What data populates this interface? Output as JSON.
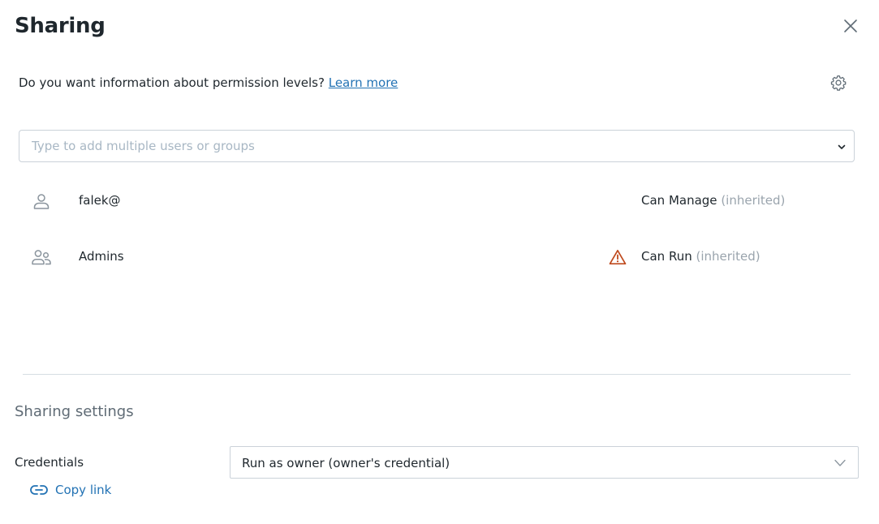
{
  "dialog": {
    "title": "Sharing",
    "close_icon": "close-icon"
  },
  "info": {
    "text": "Do you want information about permission levels? ",
    "link_label": "Learn more",
    "settings_icon": "gear-icon"
  },
  "picker": {
    "placeholder": "Type to add multiple users or groups",
    "value": ""
  },
  "permissions": [
    {
      "principal": "falek@",
      "type_icon": "user-icon",
      "permission": "Can Manage",
      "inherited_label": "(inherited)",
      "warning": false
    },
    {
      "principal": "Admins",
      "type_icon": "group-icon",
      "permission": "Can Run",
      "inherited_label": "(inherited)",
      "warning": true
    }
  ],
  "settings": {
    "title": "Sharing settings",
    "credentials_label": "Credentials",
    "credentials_value": "Run as owner (owner's credential)"
  },
  "footer": {
    "copy_link_label": "Copy link"
  },
  "colors": {
    "link": "#2272b4",
    "warning": "#bf4a1e",
    "muted": "#9aa4ad",
    "border": "#cbd2d9"
  }
}
